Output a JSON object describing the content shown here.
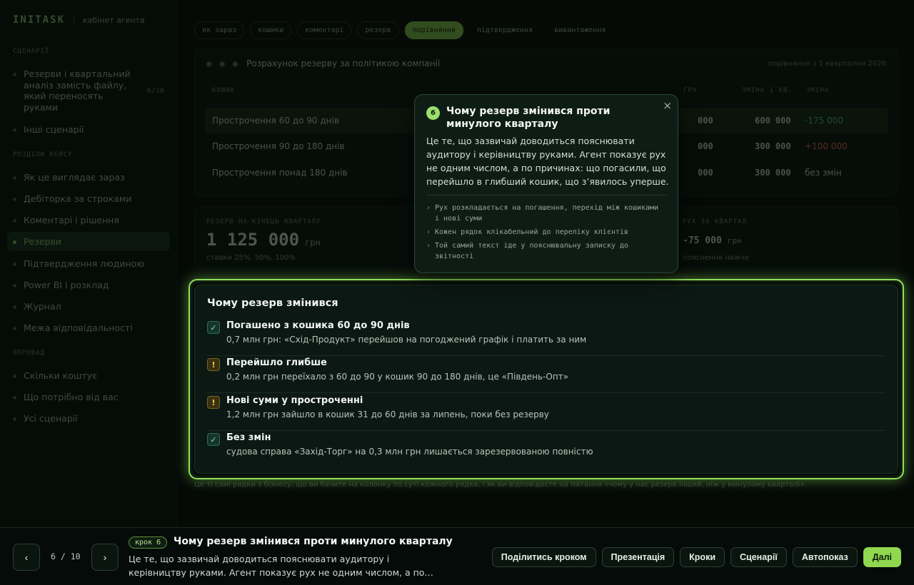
{
  "sidebar": {
    "brand": "INITASK",
    "subtitle": "кабінет агента",
    "section_scenarios": "СЦЕНАРІЇ",
    "scenarios": [
      {
        "label": "Резерви і квартальний аналіз замість файлу, який переносять руками",
        "count": "6/10"
      },
      {
        "label": "Інші сценарії"
      }
    ],
    "section_sections": "РОЗДІЛИ КЕЙСУ",
    "sections": [
      {
        "label": "Як це виглядає зараз"
      },
      {
        "label": "Дебіторка за строками"
      },
      {
        "label": "Коментарі і рішення"
      },
      {
        "label": "Резерви"
      },
      {
        "label": "Підтвердження людиною"
      },
      {
        "label": "Power BI і розклад"
      },
      {
        "label": "Журнал"
      },
      {
        "label": "Межа відповідальності"
      }
    ],
    "section_next": "ВПРОВАД",
    "next": [
      {
        "label": "Скільки коштує"
      },
      {
        "label": "Що потрібно від вас"
      },
      {
        "label": "Усі сценарії"
      }
    ]
  },
  "chips": [
    "як зараз",
    "кошики",
    "коментарі",
    "резерв",
    "порівняння",
    "підтвердження",
    "вивантаження"
  ],
  "table": {
    "title": "Розрахунок резерву за політикою компанії",
    "dots": "● ● ●",
    "note": "порівняння з 1 кварталом 2026",
    "headers": {
      "c1": "КОШИК",
      "c2": "ГРН",
      "c3": "ЗМІНА 1 КВ.",
      "c4": "ЗМІНА"
    },
    "rows": [
      {
        "name": "Прострочення 60 до 90 днів",
        "a": "000",
        "b": "600 000",
        "c": "-175 000",
        "c_color": "green"
      },
      {
        "name": "Прострочення 90 до 180 днів",
        "a": "000",
        "b": "300 000",
        "c": "+100 000",
        "c_color": "red"
      },
      {
        "name": "Прострочення понад 180 днів",
        "a": "000",
        "b": "300 000",
        "c": "без змін",
        "c_color": ""
      }
    ]
  },
  "stats": {
    "left_label": "РЕЗЕРВ НА КІНЕЦЬ КВАРТАЛУ",
    "left_value": "1 125 000",
    "left_unit": "грн",
    "left_sub": "ставки 25%, 50%, 100%",
    "right_label": "РУХ ЗА КВАРТАЛ",
    "right_value": "-75 000",
    "right_unit": "грн",
    "right_sub": "пояснення нижче"
  },
  "footnote": "Це ті самі рядки з бізнесу, що ви бачите на колонку по суті кожного рядка, і як ви відповідаєте на питання «чому у нас резерв інший, ніж у минулому кварталі».",
  "card": {
    "title": "Чому резерв змінився",
    "reasons": [
      {
        "type": "ok",
        "mark": "✓",
        "title": "Погашено з кошика 60 до 90 днів",
        "desc": "0,7 млн грн: «Схід-Продукт» перейшов на погоджений графік і платить за ним"
      },
      {
        "type": "warn",
        "mark": "!",
        "title": "Перейшло глибше",
        "desc": "0,2 млн грн переїхало з 60 до 90 у кошик 90 до 180 днів, це «Південь-Опт»"
      },
      {
        "type": "warn",
        "mark": "!",
        "title": "Нові суми у простроченні",
        "desc": "1,2 млн грн зайшло в кошик 31 до 60 днів за липень, поки без резерву"
      },
      {
        "type": "ok",
        "mark": "✓",
        "title": "Без змін",
        "desc": "судова справа «Захід-Торг» на 0,3 млн грн лишається зарезервованою повністю"
      }
    ]
  },
  "popover": {
    "number": "6",
    "title": "Чому резерв змінився проти минулого кварталу",
    "close": "×",
    "body": "Це те, що зазвичай доводиться пояснювати аудитору і керівництву руками. Агент показує рух не одним числом, а по причинах: що погасили, що перейшло в глибший кошик, що з’явилось уперше.",
    "points": [
      "Рух розкладається на погашення, перехід між кошиками і нові суми",
      "Кожен рядок клікабельний до переліку клієнтів",
      "Той самий текст іде у пояснювальну записку до звітності"
    ]
  },
  "bottombar": {
    "prev": "‹",
    "next": "›",
    "counter": "6 / 10",
    "step_chip": "крок 6",
    "step_title": "Чому резерв змінився проти минулого кварталу",
    "step_desc": "Це те, що зазвичай доводиться пояснювати аудитору і керівництву руками. Агент показує рух не одним числом, а по…",
    "actions": {
      "share": "Поділитись кроком",
      "presentation": "Презентація",
      "steps": "Кроки",
      "scenarios": "Сценарії",
      "autoplay": "Автопоказ",
      "next": "Далі"
    }
  }
}
